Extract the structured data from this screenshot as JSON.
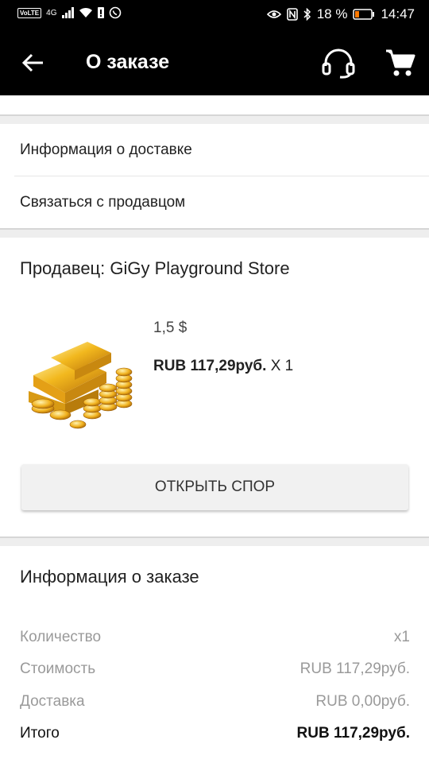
{
  "status_bar": {
    "network": "4G",
    "battery_percent": "18 %",
    "time": "14:47"
  },
  "appbar": {
    "title": "О заказе"
  },
  "links": {
    "delivery_info": "Информация о доставке",
    "contact_seller": "Связаться с продавцом"
  },
  "seller": {
    "label": "Продавец: GiGy Playground Store"
  },
  "product": {
    "price_usd": "1,5 $",
    "price_rub": "RUB 117,29руб.",
    "quantity": "X 1"
  },
  "dispute_button": "ОТКРЫТЬ СПОР",
  "order_info": {
    "title": "Информация о заказе",
    "rows": [
      {
        "label": "Количество",
        "value": "x1"
      },
      {
        "label": "Стоимость",
        "value": "RUB 117,29руб."
      },
      {
        "label": "Доставка",
        "value": "RUB 0,00руб."
      },
      {
        "label": "Итого",
        "value": "RUB 117,29руб."
      }
    ]
  },
  "colors": {
    "appbar_bg": "#000000",
    "band_bg": "#eeeeee",
    "muted_text": "#9a9a9a",
    "button_bg": "#f1f1f1"
  }
}
